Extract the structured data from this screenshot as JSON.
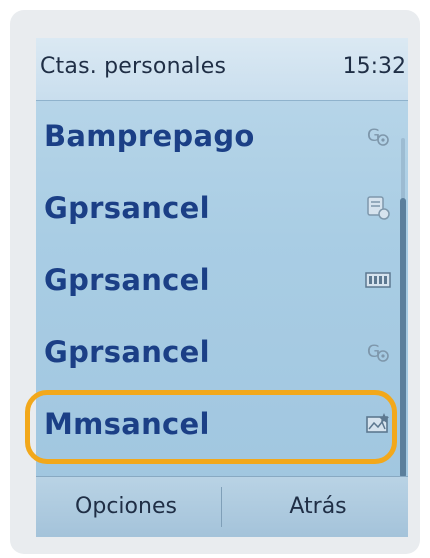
{
  "header": {
    "title": "Ctas. personales",
    "time": "15:32"
  },
  "list": {
    "items": [
      {
        "label": "Bamprepago",
        "icon": "gprs-icon"
      },
      {
        "label": "Gprsancel",
        "icon": "message-icon"
      },
      {
        "label": "Gprsancel",
        "icon": "film-icon"
      },
      {
        "label": "Gprsancel",
        "icon": "gprs-icon"
      },
      {
        "label": "Mmsancel",
        "icon": "mms-icon"
      }
    ]
  },
  "softkeys": {
    "left": "Opciones",
    "right": "Atrás"
  },
  "colors": {
    "highlight": "#f2a81b",
    "label": "#1b3f86"
  }
}
